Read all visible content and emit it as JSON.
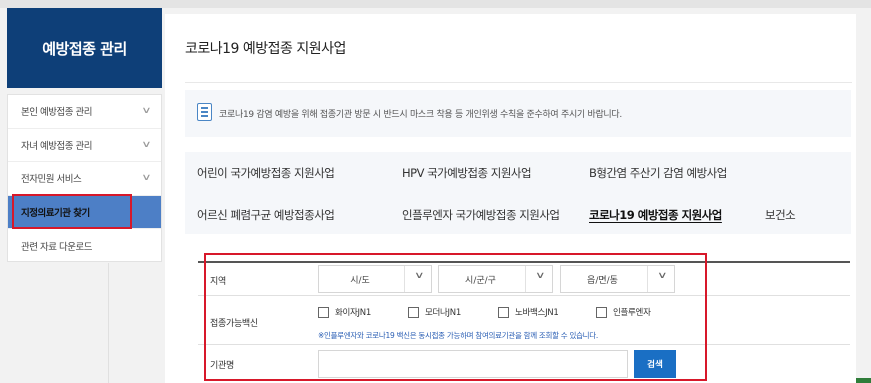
{
  "sidebar": {
    "title": "예방접종 관리",
    "items": [
      {
        "label": "본인 예방접종 관리",
        "chevron": "chevron-down-icon"
      },
      {
        "label": "자녀 예방접종 관리",
        "chevron": "chevron-down-icon"
      },
      {
        "label": "전자민원 서비스",
        "chevron": "chevron-down-icon"
      },
      {
        "label": "지정의료기관 찾기",
        "active": true
      },
      {
        "label": "관련 자료 다운로드"
      }
    ]
  },
  "main": {
    "title": "코로나19 예방접종 지원사업",
    "notice": "코로나19 감염 예방을 위해 접종기관 방문 시 반드시 마스크 착용 등 개인위생 수칙을 준수하여 주시기 바랍니다.",
    "tabs": [
      {
        "label": "어린이 국가예방접종 지원사업"
      },
      {
        "label": "HPV 국가예방접종 지원사업"
      },
      {
        "label": "B형간염 주산기 감염 예방사업"
      },
      {
        "label": "어르신 폐렴구균 예방접종사업"
      },
      {
        "label": "인플루엔자 국가예방접종 지원사업"
      },
      {
        "label": "코로나19 예방접종 지원사업",
        "active": true
      },
      {
        "label": "보건소"
      }
    ]
  },
  "search_form": {
    "region_label": "지역",
    "selects": [
      "시/도",
      "시/군/구",
      "읍/면/동"
    ],
    "vaccine_label": "접종가능백신",
    "vaccines": [
      "화이자JN1",
      "모더나JN1",
      "노바백스JN1",
      "인플루엔자"
    ],
    "vaccine_note": "※인플루엔자와 코로나19 백신은 동시접종 가능하며 참여의료기관을 함께 조회할 수 있습니다.",
    "institution_label": "기관명",
    "institution_value": "",
    "search_button": "검색"
  },
  "colors": {
    "sidebar_header": "#0e3f78",
    "active_menu": "#4d7fc6",
    "highlight_box": "#d7182a",
    "search_button": "#1a6fc4",
    "note_text": "#2b5fb4"
  }
}
